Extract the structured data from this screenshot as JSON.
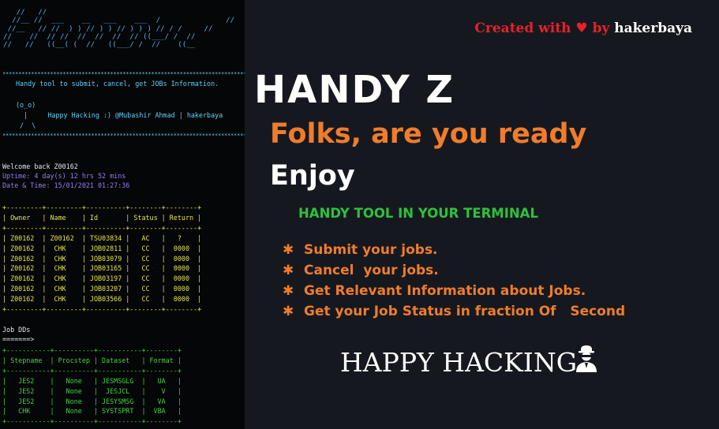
{
  "terminal": {
    "banner": "                                                        __\n   //   //                                                //\n  //__ //  ___    __   ___    ___  /               //\n //__   // //  ) ) // ) ) // ) ) ) // / /     //\n//    //  // //  //  //  //  // ((___/ /  //\n//   //   ((__( (  //   ((___/ /  //    ((__\n",
    "stars": "*************************************************************************************",
    "tagline": "Handy tool to submit, cancel, get JOBs Information.",
    "face": "(o_o)",
    "greeting": "  |     Happy Hacking :) @Mubashir Ahmad | hakerbaya",
    "legs": " /  \\",
    "welcome": "Welcome back Z00162",
    "uptime": "Uptime: 4 day(s) 12 hrs 52 mins",
    "datetime": "Date & Time: 15/01/2021 01:27:36",
    "jobs_table": "+---------+---------+----------+--------+--------+\n| Owner   | Name    | Id       | Status | Return |\n+---------+---------+----------+--------+--------+\n| Z00162  | Z00162  | TSU03834 |   AC   |   ?    |\n| Z00162  |  CHK    | JOB02811 |   CC   |  0000  |\n| Z00162  |  CHK    | JOB03079 |   CC   |  0000  |\n| Z00162  |  CHK    | JOB03165 |   CC   |  0000  |\n| Z00162  |  CHK    | JOB03197 |   CC   |  0000  |\n| Z00162  |  CHK    | JOB03207 |   CC   |  0000  |\n| Z00162  |  CHK    | JOB03566 |   CC   |  0000  |\n+---------+---------+----------+--------+--------+",
    "job_dds_label": "Job DDs",
    "arrow": "=======>",
    "dds_table": "+-----------+----------+-----------+--------+\n| Stepname  | Procstep | Dataset   | Format |\n+-----------+----------+-----------+--------+\n|   JES2    |   None   | JESMSGLG  |   UA   |\n|   JES2    |   None   |  JESJCL   |    V   |\n|   JES2    |   None   | JESYSMSG  |   VA   |\n|   CHK     |   None   | SYSTSPRT  |  VBA   |\n+-----------+----------+-----------+--------+"
  },
  "promo": {
    "credit_prefix": "Created with",
    "heart": "♥",
    "credit_by": "by",
    "credit_name": "hakerbaya",
    "title": "HANDY Z",
    "subtitle": "Folks, are you ready",
    "enjoy": "Enjoy",
    "green_line": "HANDY TOOL IN YOUR TERMINAL",
    "bullet": "✱",
    "features": [
      "Submit your jobs.",
      "Cancel  your jobs.",
      "Get Relevant Information about Jobs.",
      "Get your Job Status in fraction Of   Second"
    ],
    "closing": "HAPPY HACKING",
    "closing_icon": "hacker-icon",
    "accent_orange": "#f07c2c",
    "accent_green": "#2ec13e",
    "heart_red": "#e8202a"
  }
}
